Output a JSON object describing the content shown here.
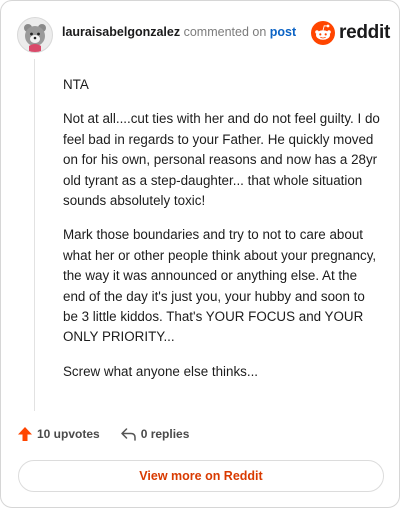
{
  "header": {
    "username": "lauraisabelgonzalez",
    "action_text": "commented on",
    "post_link": "post",
    "logo_text": "reddit"
  },
  "icons": {
    "avatar": "bear-avatar-icon",
    "logo": "reddit-snoo-icon",
    "upvote": "upvote-arrow-icon",
    "reply": "reply-arrow-icon"
  },
  "comment": {
    "paragraphs": [
      "NTA",
      "Not at all....cut ties with her and do not feel guilty. I do feel bad in regards to your Father. He quickly moved on for his own, personal reasons and now has a 28yr old tyrant as a step-daughter... that whole situation sounds absolutely toxic!",
      "Mark those boundaries and try to not to care about what her or other people think about your pregnancy, the way it was announced or anything else. At the end of the day it's just you, your hubby and soon to be 3 little kiddos. That's YOUR FOCUS and YOUR ONLY PRIORITY...",
      "Screw what anyone else thinks..."
    ]
  },
  "actions": {
    "upvotes": "10 upvotes",
    "replies": "0 replies"
  },
  "footer": {
    "view_more": "View more on Reddit"
  },
  "colors": {
    "brand": "#ff4500",
    "link": "#0b63c5",
    "cta": "#d93a00"
  }
}
